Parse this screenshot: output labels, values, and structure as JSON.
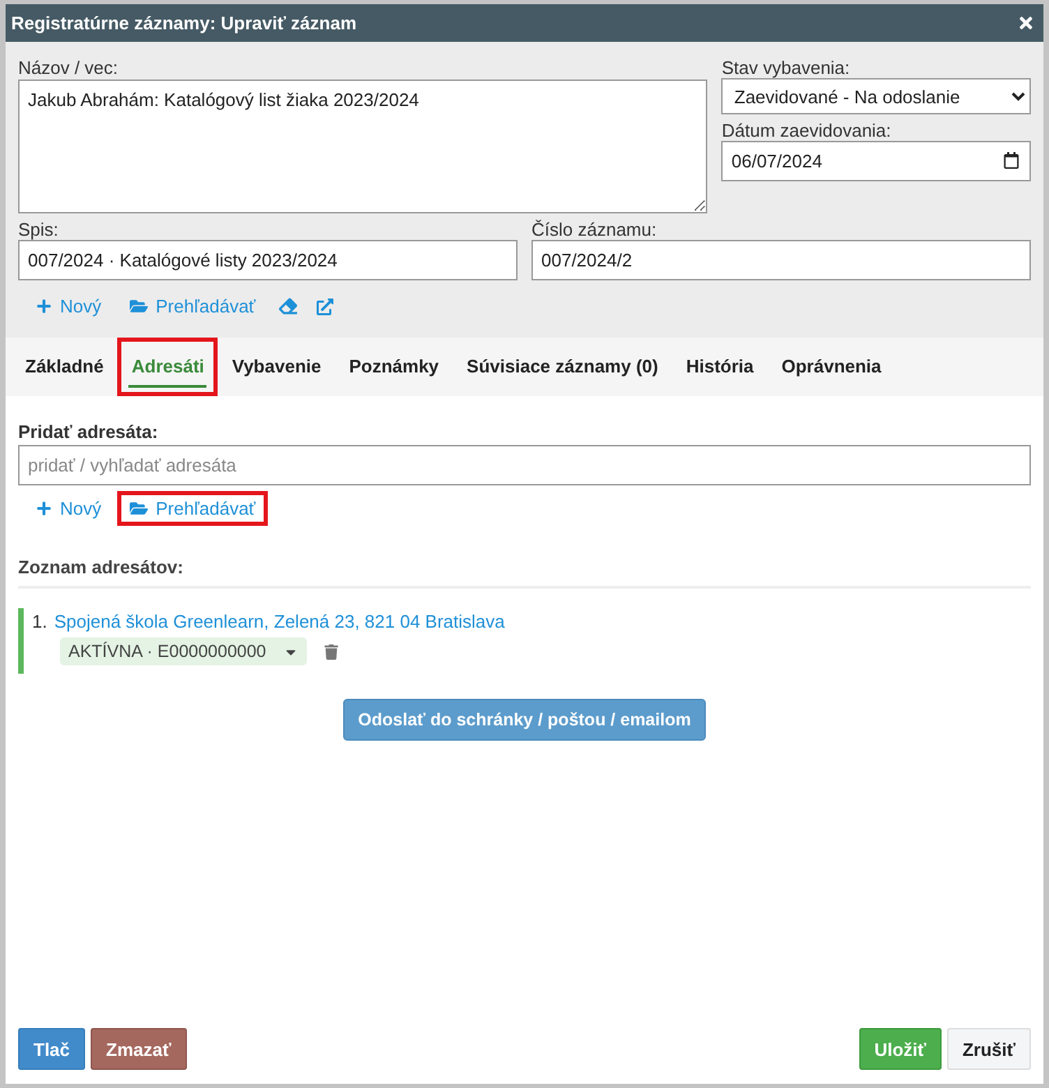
{
  "window": {
    "title": "Registratúrne záznamy: Upraviť záznam"
  },
  "subject": {
    "label": "Názov / vec:",
    "value": "Jakub Abrahám: Katalógový list žiaka 2023/2024"
  },
  "status": {
    "label": "Stav vybavenia:",
    "value": "Zaevidované - Na odoslanie"
  },
  "date": {
    "label": "Dátum zaevidovania:",
    "value": "06/07/2024"
  },
  "file": {
    "label": "Spis:",
    "value": "007/2024 · Katalógové listy 2023/2024"
  },
  "record_number": {
    "label": "Číslo záznamu:",
    "value": "007/2024/2"
  },
  "file_actions": [
    {
      "kind": "new",
      "label": "Nový"
    },
    {
      "kind": "browse",
      "label": "Prehľadávať"
    },
    {
      "kind": "erase"
    },
    {
      "kind": "external"
    }
  ],
  "tabs": [
    {
      "label": "Základné",
      "selected": false,
      "highlighted": false
    },
    {
      "label": "Adresáti",
      "selected": true,
      "highlighted": true
    },
    {
      "label": "Vybavenie",
      "selected": false,
      "highlighted": false
    },
    {
      "label": "Poznámky",
      "selected": false,
      "highlighted": false
    },
    {
      "label": "Súvisiace záznamy (0)",
      "selected": false,
      "highlighted": false
    },
    {
      "label": "História",
      "selected": false,
      "highlighted": false
    },
    {
      "label": "Oprávnenia",
      "selected": false,
      "highlighted": false
    }
  ],
  "add_recipient": {
    "label": "Pridať adresáta:",
    "placeholder": "pridať / vyhľadať adresáta",
    "actions": [
      {
        "kind": "new",
        "label": "Nový",
        "highlighted": false
      },
      {
        "kind": "browse",
        "label": "Prehľadávať",
        "highlighted": true
      }
    ]
  },
  "recipients": {
    "heading": "Zoznam adresátov:",
    "items": [
      {
        "number": "1.",
        "name": "Spojená škola Greenlearn, Zelená 23, 821 04 Bratislava",
        "status": "AKTÍVNA · E0000000000"
      }
    ]
  },
  "send_button": "Odoslať do schránky / poštou / emailom",
  "footer": {
    "left": [
      {
        "kind": "primary",
        "label": "Tlač"
      },
      {
        "kind": "danger",
        "label": "Zmazať"
      }
    ],
    "right": [
      {
        "kind": "success",
        "label": "Uložiť"
      },
      {
        "kind": "default",
        "label": "Zrušiť"
      }
    ]
  }
}
